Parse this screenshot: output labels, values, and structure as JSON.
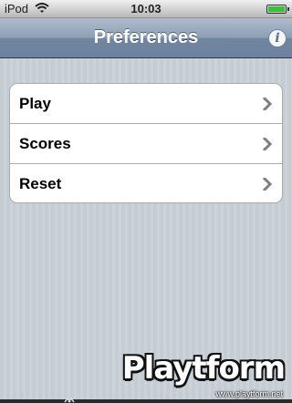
{
  "status_bar": {
    "carrier": "iPod",
    "time": "10:03",
    "battery_level": 1.0
  },
  "nav_bar": {
    "title": "Preferences",
    "info_icon": "info-icon"
  },
  "menu": {
    "items": [
      {
        "label": "Play",
        "icon": "chevron-right-icon"
      },
      {
        "label": "Scores",
        "icon": "chevron-right-icon"
      },
      {
        "label": "Reset",
        "icon": "chevron-right-icon"
      }
    ]
  },
  "watermark": {
    "logo": "Playtform",
    "url": "www.playtform.net"
  },
  "colors": {
    "navbar": "#6d83a1",
    "background": "#c5ccd4",
    "chevron": "#808080"
  }
}
